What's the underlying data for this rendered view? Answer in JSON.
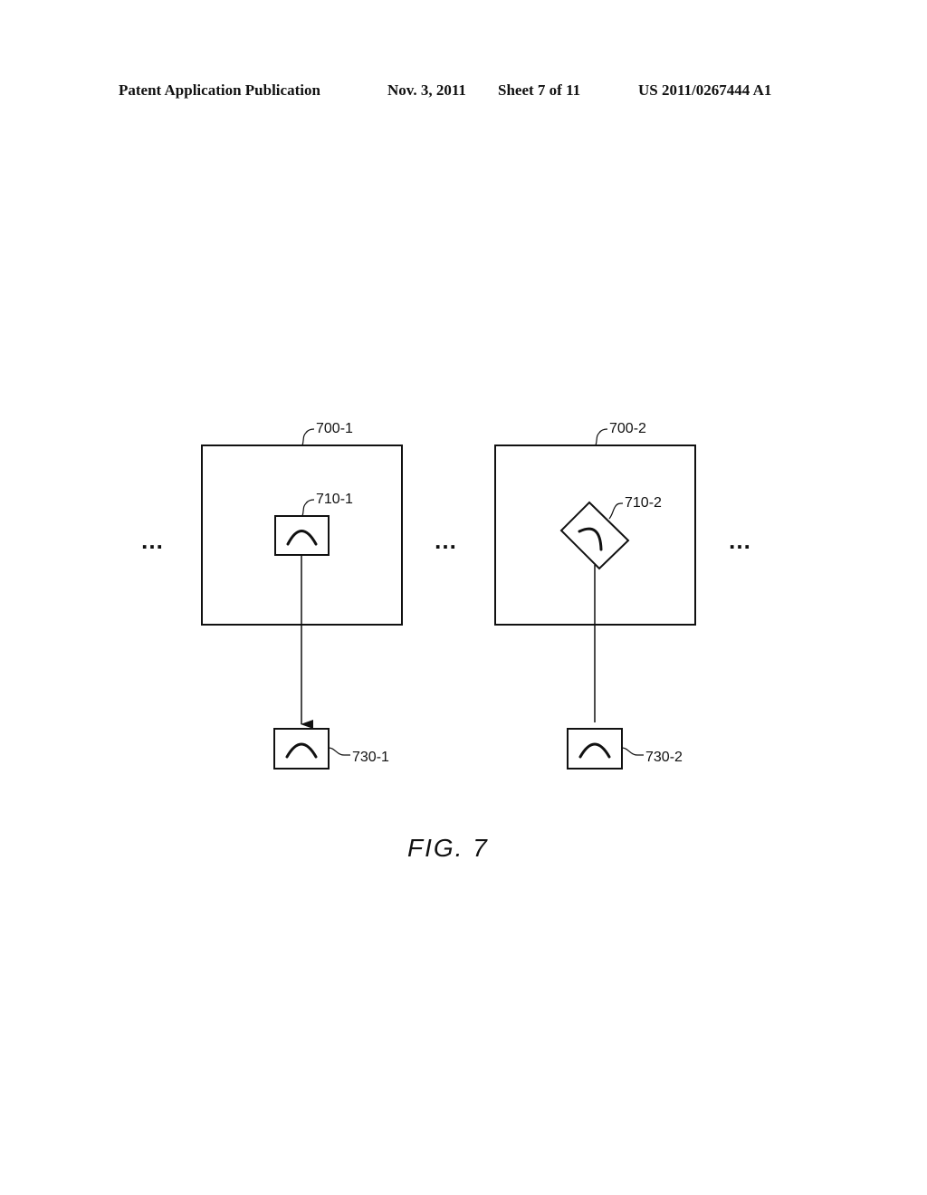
{
  "header": {
    "publication": "Patent Application Publication",
    "date": "Nov. 3, 2011",
    "sheet": "Sheet 7 of 11",
    "number": "US 2011/0267444 A1"
  },
  "figure": {
    "caption": "FIG. 7",
    "frames": [
      {
        "id": "700-1",
        "inner_label": "710-1",
        "inner_orientation": "upright",
        "output_label": "730-1",
        "connector": "arrow"
      },
      {
        "id": "700-2",
        "inner_label": "710-2",
        "inner_orientation": "rotated",
        "output_label": "730-2",
        "connector": "line"
      }
    ],
    "ellipses": [
      "…",
      "…",
      "…"
    ]
  }
}
